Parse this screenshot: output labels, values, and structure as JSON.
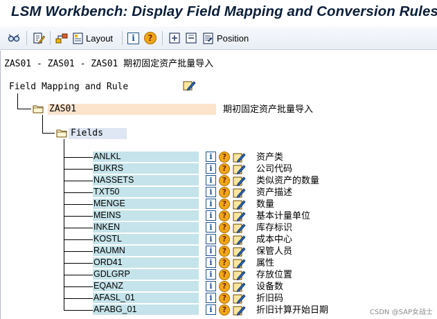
{
  "window": {
    "title": "LSM Workbench: Display Field Mapping and Conversion Rules"
  },
  "toolbar": {
    "layout_label": "Layout",
    "position_label": "Position"
  },
  "header": {
    "line": "ZAS01 - ZAS01 - ZAS01 期初固定资产批量导入"
  },
  "tree": {
    "root_label": "Field Mapping and Rule",
    "structure": {
      "name": "ZAS01",
      "description": "期初固定资产批量导入"
    },
    "fields_node": "Fields",
    "fields": [
      {
        "name": "ANLKL",
        "description": "资产类"
      },
      {
        "name": "BUKRS",
        "description": "公司代码"
      },
      {
        "name": "NASSETS",
        "description": "类似资产的数量"
      },
      {
        "name": "TXT50",
        "description": "资产描述"
      },
      {
        "name": "MENGE",
        "description": "数量"
      },
      {
        "name": "MEINS",
        "description": "基本计量单位"
      },
      {
        "name": "INKEN",
        "description": "库存标识"
      },
      {
        "name": "KOSTL",
        "description": "成本中心"
      },
      {
        "name": "RAUMN",
        "description": "保管人员"
      },
      {
        "name": "ORD41",
        "description": "属性"
      },
      {
        "name": "GDLGRP",
        "description": "存放位置"
      },
      {
        "name": "EQANZ",
        "description": "设备数"
      },
      {
        "name": "AFASL_01",
        "description": "折旧码"
      },
      {
        "name": "AFABG_01",
        "description": "折旧计算开始日期"
      }
    ]
  },
  "icons": {
    "info": "info-icon",
    "help": "question-icon",
    "edit": "pencil-icon",
    "folder": "folder-icon"
  },
  "watermark": "CSDN @SAP女战士",
  "colors": {
    "field_bg": "#c5e3ea",
    "structure_bg": "#fbe3cc",
    "fields_node_bg": "#dde6f2",
    "title": "#0b1f3a"
  }
}
